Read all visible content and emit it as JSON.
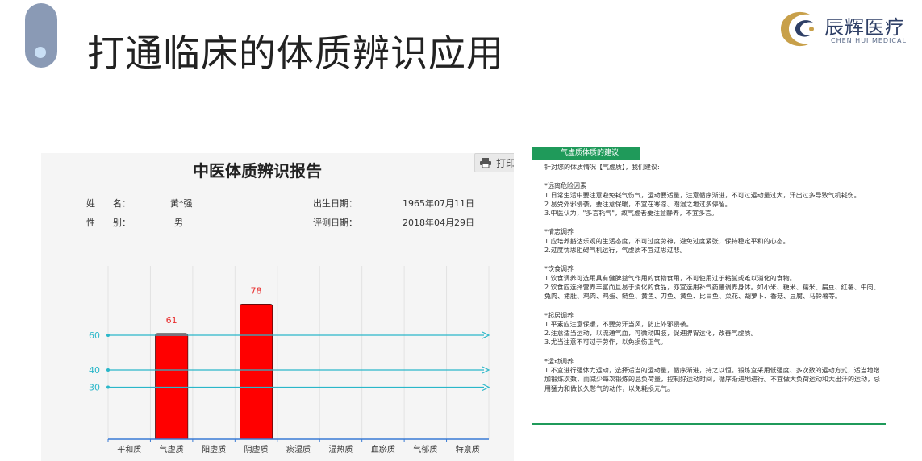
{
  "slide": {
    "title": "打通临床的体质辨识应用"
  },
  "logo": {
    "brand": "辰辉医疗",
    "brand_en": "CHEN HUI MEDICAL"
  },
  "report": {
    "title": "中医体质辨识报告",
    "print_label": "打印",
    "name_label": "姓　　名：",
    "name_value": "黄*强",
    "gender_label": "性　　别：",
    "gender_value": "男",
    "birth_label": "出生日期：",
    "birth_value": "1965年07月11日",
    "eval_label": "评测日期：",
    "eval_value": "2018年04月29日"
  },
  "chart_data": {
    "type": "bar",
    "categories": [
      "平和质",
      "气虚质",
      "阳虚质",
      "阴虚质",
      "痰湿质",
      "湿热质",
      "血瘀质",
      "气郁质",
      "特禀质"
    ],
    "values": [
      null,
      61,
      null,
      78,
      null,
      null,
      null,
      null,
      null
    ],
    "reference_lines": [
      60,
      40,
      30
    ],
    "ylim": [
      0,
      100
    ],
    "bar_color": "#ff0000",
    "reference_color": "#2ab7c9",
    "label_color": "#e83030"
  },
  "advice": {
    "tab_label": "气虚质体质的建议",
    "paragraphs": [
      "针对您的体质情况【气虚质】，我们建议:",
      "",
      "*远离危险因素",
      "1.日常生活中要注意避免耗气伤气，运动要适量，注意循序渐进，不可过运动量过大，汗出过多导致气机耗伤。",
      "2.易受外邪侵袭，要注意保暖，不宜在寒凉、潮湿之地过多停留。",
      "3.中医认为，\"多言耗气\"，故气虚者要注意静养，不宜多言。",
      "",
      "*情志调养",
      "1.应培养豁达乐观的生活态度，不可过度劳神，避免过度紧张，保持稳定平和的心态。",
      "2.过度忧思阻碍气机运行，气虚质不宜过思过悲。",
      "",
      "*饮食调养",
      "1.饮食调养可选用具有健脾益气作用的食物食用，不可使用过于粘腻或难以消化的食物。",
      "2.饮食应选择营养丰富而且易于消化的食品，亦宜选用补气药膳调养身体。如小米、粳米、糯米、扁豆、红薯、牛肉、兔肉、猪肚、鸡肉、鸡蛋、鲢鱼、黄鱼、刀鱼、黄鱼、比目鱼、菜花、胡萝卜、香菇、豆腐、马铃薯等。",
      "",
      "*起居调养",
      "1.平素应注意保暖，不要劳汗当风，防止外邪侵袭。",
      "2.注意适当运动，以流通气血，可微动四肢，促进脾胃运化，改善气虚质。",
      "3.尤当注意不可过于劳作，以免损伤正气。",
      "",
      "*运动调养",
      "1.不宜进行强体力运动，选择适当的运动量，循序渐进，持之以恒。锻炼宜采用低强度、多次数的运动方式，适当地增加锻炼次数，而减少每次锻炼的总负荷量，控制好运动时间，循序渐进地进行。不宜做大负荷运动和大出汗的运动，忌用猛力和做长久憋气的动作，以免耗损元气。"
    ]
  }
}
